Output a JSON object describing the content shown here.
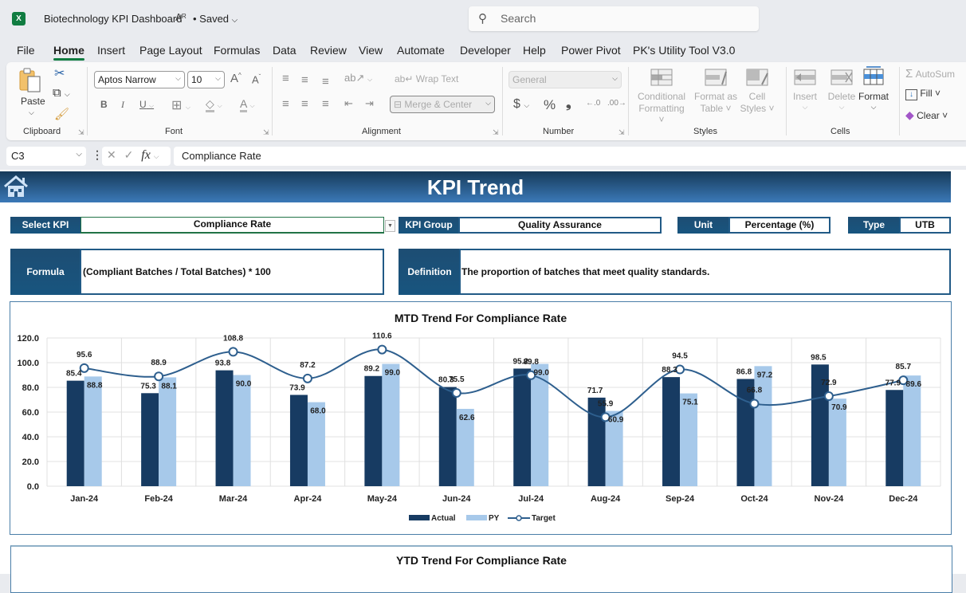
{
  "titlebar": {
    "app_icon": "excel-icon",
    "doc_title": "Biotechnology KPI Dashboard",
    "save_status": "• Saved",
    "search_placeholder": "Search"
  },
  "menu": [
    "File",
    "Home",
    "Insert",
    "Page Layout",
    "Formulas",
    "Data",
    "Review",
    "View",
    "Automate",
    "Developer",
    "Help",
    "Power Pivot",
    "PK's Utility Tool V3.0"
  ],
  "active_menu": "Home",
  "ribbon": {
    "clipboard": {
      "paste": "Paste",
      "label": "Clipboard"
    },
    "font": {
      "name": "Aptos Narrow",
      "size": "10",
      "label": "Font",
      "bold": "B",
      "italic": "I",
      "underline": "U"
    },
    "alignment": {
      "wrap_text": "Wrap Text",
      "merge_center": "Merge & Center",
      "label": "Alignment"
    },
    "number": {
      "format": "General",
      "currency": "$",
      "percent": "%",
      "comma": "❟",
      "label": "Number"
    },
    "styles": {
      "conditional": [
        "Conditional",
        "Formatting ˅"
      ],
      "format_table": [
        "Format as",
        "Table ˅"
      ],
      "cell_styles": [
        "Cell",
        "Styles ˅"
      ],
      "label": "Styles"
    },
    "cells": {
      "insert": "Insert",
      "delete": "Delete",
      "format": "Format",
      "label": "Cells"
    },
    "editing": {
      "autosum": "AutoSum",
      "fill": "Fill ˅",
      "clear": "Clear ˅"
    }
  },
  "formula_bar": {
    "cell_ref": "C3",
    "content": "Compliance Rate"
  },
  "dashboard": {
    "title": "KPI Trend",
    "select_kpi_label": "Select KPI",
    "select_kpi_value": "Compliance Rate",
    "kpi_group_label": "KPI Group",
    "kpi_group_value": "Quality Assurance",
    "unit_label": "Unit",
    "unit_value": "Percentage (%)",
    "type_label": "Type",
    "type_value": "UTB",
    "formula_label": "Formula",
    "formula_value": "(Compliant Batches / Total Batches) * 100",
    "definition_label": "Definition",
    "definition_value": "The proportion of batches that meet quality standards.",
    "ytd_title": "YTD Trend For Compliance Rate"
  },
  "colors": {
    "actual": "#173b62",
    "py": "#a7c9ea",
    "target": "#2e5f8e",
    "banner_top": "#163a59",
    "banner_bottom": "#3b79b8"
  },
  "chart_data": {
    "type": "bar",
    "title": "MTD Trend For Compliance Rate",
    "categories": [
      "Jan-24",
      "Feb-24",
      "Mar-24",
      "Apr-24",
      "May-24",
      "Jun-24",
      "Jul-24",
      "Aug-24",
      "Sep-24",
      "Oct-24",
      "Nov-24",
      "Dec-24"
    ],
    "series": [
      {
        "name": "Actual",
        "type": "bar",
        "values": [
          85.4,
          75.3,
          93.8,
          73.9,
          89.2,
          80.3,
          95.2,
          71.7,
          88.3,
          86.8,
          98.5,
          77.9
        ]
      },
      {
        "name": "PY",
        "type": "bar",
        "values": [
          88.8,
          88.1,
          90.0,
          68.0,
          99.0,
          62.6,
          99.0,
          60.9,
          75.1,
          97.2,
          70.9,
          89.6
        ]
      },
      {
        "name": "Target",
        "type": "line",
        "values": [
          95.6,
          88.9,
          108.8,
          87.2,
          110.6,
          75.5,
          89.8,
          55.9,
          94.5,
          66.8,
          72.9,
          85.7
        ]
      }
    ],
    "yticks": [
      "0.0",
      "20.0",
      "40.0",
      "60.0",
      "80.0",
      "100.0",
      "120.0"
    ],
    "ylim": [
      0,
      120
    ],
    "xlabel": "",
    "ylabel": "",
    "grid": true,
    "legend": "bottom"
  }
}
